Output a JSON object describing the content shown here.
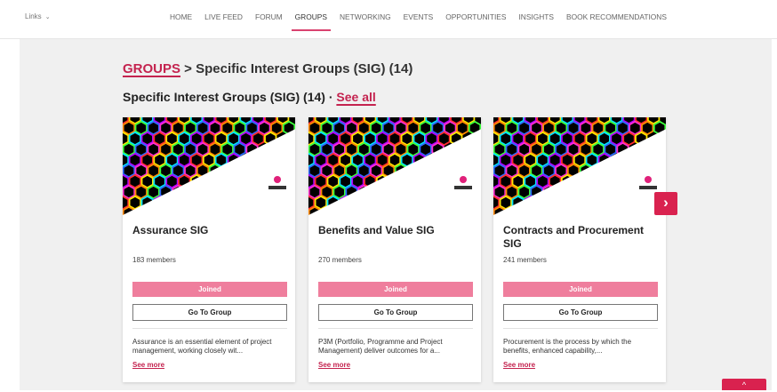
{
  "header": {
    "links_label": "Links",
    "links_chevron": "⌄",
    "nav": [
      {
        "label": "HOME",
        "active": false
      },
      {
        "label": "LIVE FEED",
        "active": false
      },
      {
        "label": "FORUM",
        "active": false
      },
      {
        "label": "GROUPS",
        "active": true
      },
      {
        "label": "NETWORKING",
        "active": false
      },
      {
        "label": "EVENTS",
        "active": false
      },
      {
        "label": "OPPORTUNITIES",
        "active": false
      },
      {
        "label": "INSIGHTS",
        "active": false
      },
      {
        "label": "BOOK RECOMMENDATIONS",
        "active": false
      }
    ]
  },
  "breadcrumb": {
    "root": "GROUPS",
    "separator": " > ",
    "current": "Specific Interest Groups (SIG) (14)"
  },
  "section": {
    "title": "Specific Interest Groups (SIG) (14)",
    "separator": " · ",
    "see_all": "See all"
  },
  "cards": [
    {
      "title": "Assurance SIG",
      "members": "183 members",
      "joined_label": "Joined",
      "go_label": "Go To Group",
      "description": "Assurance is an essential element of project management, working closely wit...",
      "see_more": "See more"
    },
    {
      "title": "Benefits and Value SIG",
      "members": "270 members",
      "joined_label": "Joined",
      "go_label": "Go To Group",
      "description": "P3M (Portfolio, Programme and Project Management) deliver outcomes for a...",
      "see_more": "See more"
    },
    {
      "title": "Contracts and Procurement SIG",
      "members": "241 members",
      "joined_label": "Joined",
      "go_label": "Go To Group",
      "description": "Procurement is the process by which the benefits, enhanced capability,...",
      "see_more": "See more"
    }
  ],
  "carousel": {
    "next_icon": "›"
  },
  "back_to_top": {
    "icon": "^"
  },
  "colors": {
    "accent": "#c4234f",
    "joined_button": "#ef7e9d",
    "arrow_button": "#d9224f",
    "page_background": "#f0f0f0"
  },
  "icons": [
    "chevron-down-icon",
    "chevron-right-icon",
    "chevron-up-icon",
    "hexagon-pattern-image",
    "apm-logo"
  ]
}
